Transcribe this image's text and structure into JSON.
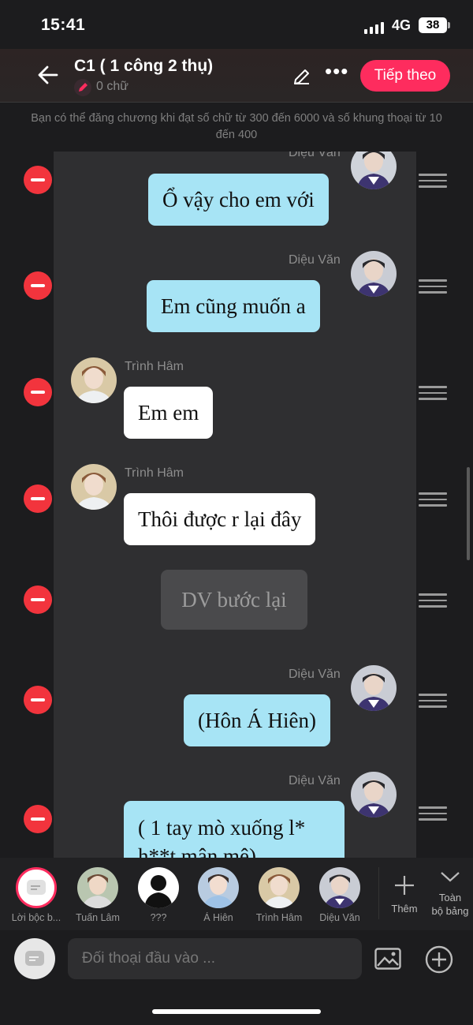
{
  "status_bar": {
    "time": "15:41",
    "network": "4G",
    "battery": "38"
  },
  "header": {
    "title": "C1 ( 1 công 2 thụ)",
    "word_count": "0 chữ",
    "next_label": "Tiếp theo",
    "accent_color": "#fe2c5e"
  },
  "notice": "Bạn có thể đăng chương khi đạt số chữ từ 300 đến 6000 và số khung thoại từ 10 đến 400",
  "messages": [
    {
      "speaker": "Diệu Văn",
      "text": "Ổ vậy cho em với",
      "side": "right",
      "style": "blue"
    },
    {
      "speaker": "Diệu Văn",
      "text": "Em cũng muốn a",
      "side": "right",
      "style": "blue"
    },
    {
      "speaker": "Trình Hâm",
      "text": "Em em",
      "side": "left",
      "style": "white"
    },
    {
      "speaker": "Trình Hâm",
      "text": "Thôi được r lại đây",
      "side": "left",
      "style": "white"
    },
    {
      "speaker": "",
      "text": "DV bước lại",
      "side": "center",
      "style": "narration"
    },
    {
      "speaker": "Diệu Văn",
      "text": "(Hôn Á Hiên)",
      "side": "right",
      "style": "blue"
    },
    {
      "speaker": "Diệu Văn",
      "text": "( 1 tay mò xuống l*",
      "text_line2": "h**t mân mê)",
      "side": "right",
      "style": "blue"
    }
  ],
  "characters": [
    {
      "name": "Lời bộc b...",
      "icon": "narrator-icon",
      "selected": true
    },
    {
      "name": "Tuấn Lâm",
      "icon": "avatar"
    },
    {
      "name": "???",
      "icon": "silhouette-avatar"
    },
    {
      "name": "Á Hiên",
      "icon": "avatar"
    },
    {
      "name": "Trình Hâm",
      "icon": "avatar"
    },
    {
      "name": "Diệu Văn",
      "icon": "avatar"
    }
  ],
  "strip_actions": {
    "add_label": "Thêm",
    "collapse_label_1": "Toàn",
    "collapse_label_2": "bộ bảng"
  },
  "input": {
    "placeholder": "Đối thoại đầu vào ..."
  }
}
